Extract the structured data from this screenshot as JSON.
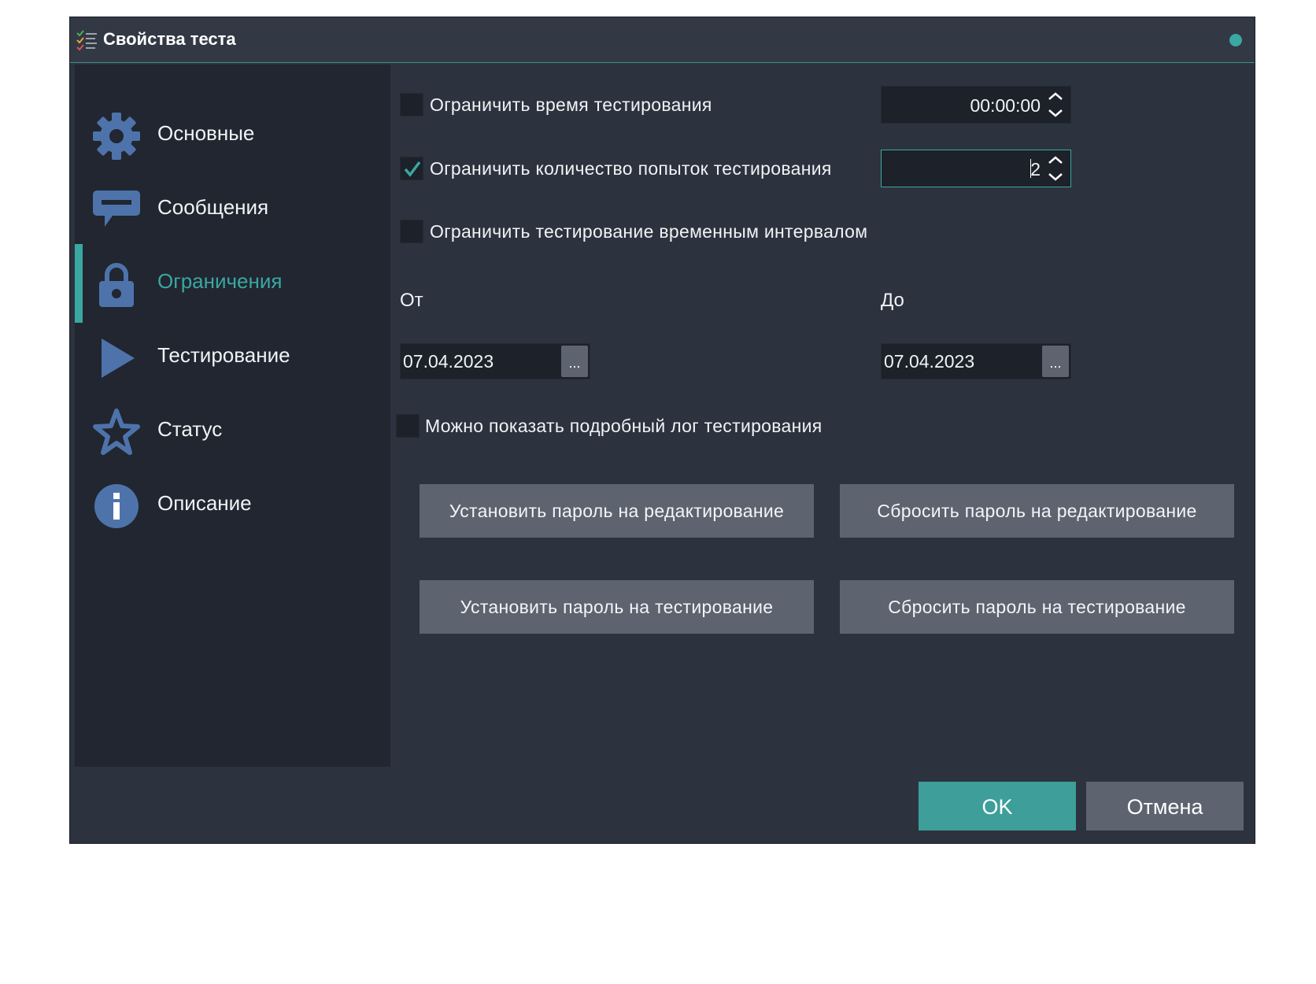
{
  "window": {
    "title": "Свойства теста"
  },
  "sidebar": {
    "items": [
      {
        "label": "Основные",
        "icon": "gear-icon",
        "active": false
      },
      {
        "label": "Сообщения",
        "icon": "message-icon",
        "active": false
      },
      {
        "label": "Ограничения",
        "icon": "lock-icon",
        "active": true
      },
      {
        "label": "Тестирование",
        "icon": "play-icon",
        "active": false
      },
      {
        "label": "Статус",
        "icon": "star-icon",
        "active": false
      },
      {
        "label": "Описание",
        "icon": "info-icon",
        "active": false
      }
    ]
  },
  "restrictions": {
    "limit_time": {
      "label": "Ограничить время тестирования",
      "checked": false,
      "value": "00:00:00"
    },
    "limit_attempts": {
      "label": "Ограничить количество попыток тестирования",
      "checked": true,
      "value": "2"
    },
    "limit_interval": {
      "label": "Ограничить тестирование временным интервалом",
      "checked": false
    },
    "from": {
      "label": "От",
      "value": "07.04.2023",
      "picker_label": "..."
    },
    "to": {
      "label": "До",
      "value": "07.04.2023",
      "picker_label": "..."
    },
    "show_log": {
      "label": "Можно показать подробный лог тестирования",
      "checked": false
    }
  },
  "buttons": {
    "set_edit_password": "Установить пароль на редактирование",
    "reset_edit_password": "Сбросить пароль на редактирование",
    "set_test_password": "Установить пароль на тестирование",
    "reset_test_password": "Сбросить пароль на тестирование",
    "ok": "OK",
    "cancel": "Отмена"
  },
  "colors": {
    "accent": "#3aa7a2",
    "icon": "#4d73aa",
    "background": "#2c333e",
    "sidebar": "#212630",
    "button": "#5d6470"
  }
}
